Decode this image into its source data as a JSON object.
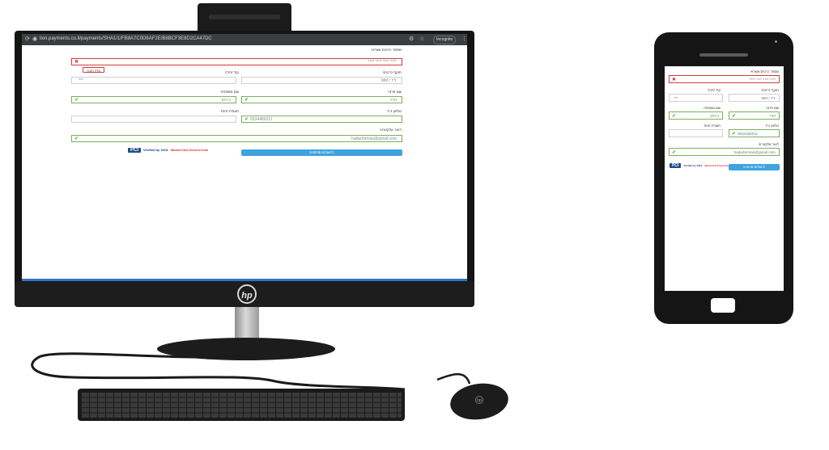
{
  "browser": {
    "url": "lion.payments.co.il/payments/SHA1/1/FB8A7C0D6AF2E/B8BCF3E8D2CA47DC",
    "incognito_label": "Incognito"
  },
  "form": {
    "card_number_label": "מספר כרטיס אשראי",
    "card_number_placeholder": "**** **** **** ****",
    "card_number_error": "שדה חובה",
    "expiry_label": "תוקף כרטיס",
    "expiry_placeholder": "MM / YY",
    "cvv_label": "קוד CVV",
    "cvv_placeholder": "***",
    "first_name_label": "שם פרטי",
    "first_name_value": "הדר",
    "last_name_label": "שם משפחה",
    "last_name_value": "בירמן",
    "phone_label": "טלפון נייד",
    "phone_value": "0534480011",
    "id_label": "תעודת זהות",
    "id_value": "",
    "email_label": "דואר אלקטרוני",
    "email_value": "hadarbirman@gmail.com",
    "pay_button_label": "לתשלום ₪ 9.90",
    "logos": {
      "pci": "PCI",
      "visa": "Verified by VISA",
      "mastercard": "MasterCard SecureCode"
    }
  },
  "colors": {
    "error": "#d53b3b",
    "success": "#3c9a2e",
    "button": "#3ea3df",
    "browser_bar": "#3b3d40"
  },
  "icons": {
    "error_mark": "✖",
    "valid_mark": "✔",
    "reload": "⟳",
    "star": "☆",
    "menu": "⋮",
    "tune": "⚙",
    "hp": "hp"
  }
}
